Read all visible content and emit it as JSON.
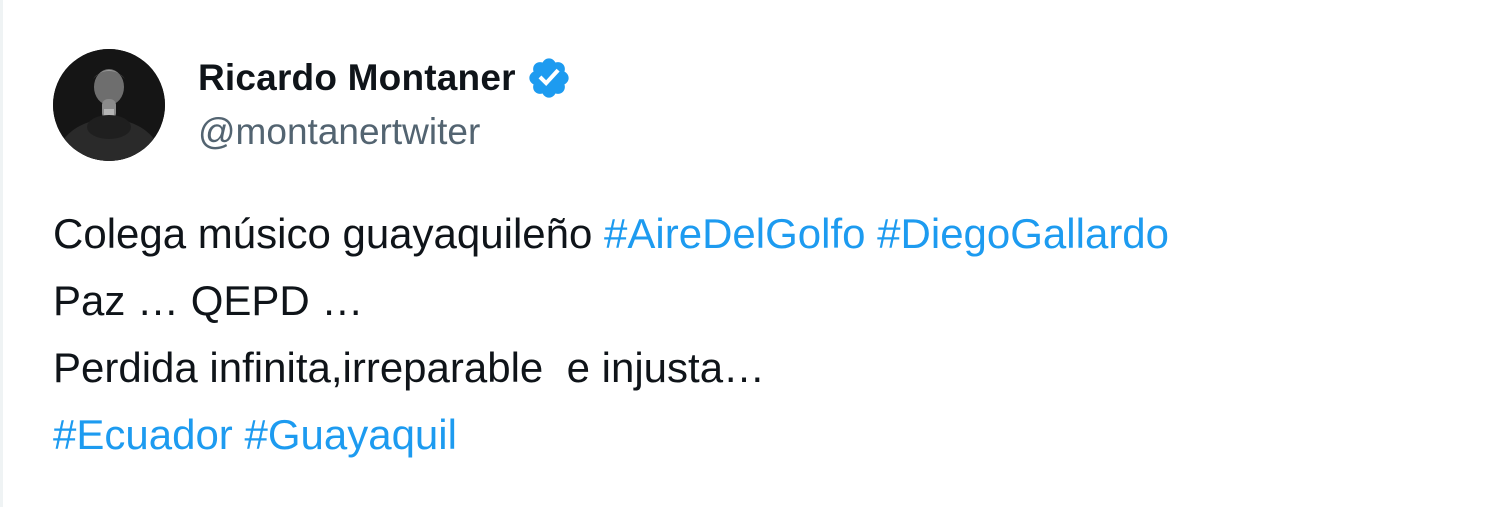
{
  "author": {
    "display_name": "Ricardo Montaner",
    "handle": "@montanertwiter",
    "verified": true,
    "verified_icon": "verified-badge-icon",
    "avatar_icon": "avatar-photo"
  },
  "tweet": {
    "line1_text": "Colega músico guayaquileño ",
    "line1_tag1": "#AireDelGolfo",
    "line1_tag2": "#DiegoGallardo",
    "line2_text": "Paz … QEPD …",
    "line3_text": "Perdida infinita,irreparable  e injusta…",
    "line4_tag1": "#Ecuador",
    "line4_tag2": "#Guayaquil"
  },
  "colors": {
    "text_primary": "#0f1419",
    "text_secondary": "#536471",
    "accent": "#1d9bf0",
    "background": "#ffffff"
  }
}
